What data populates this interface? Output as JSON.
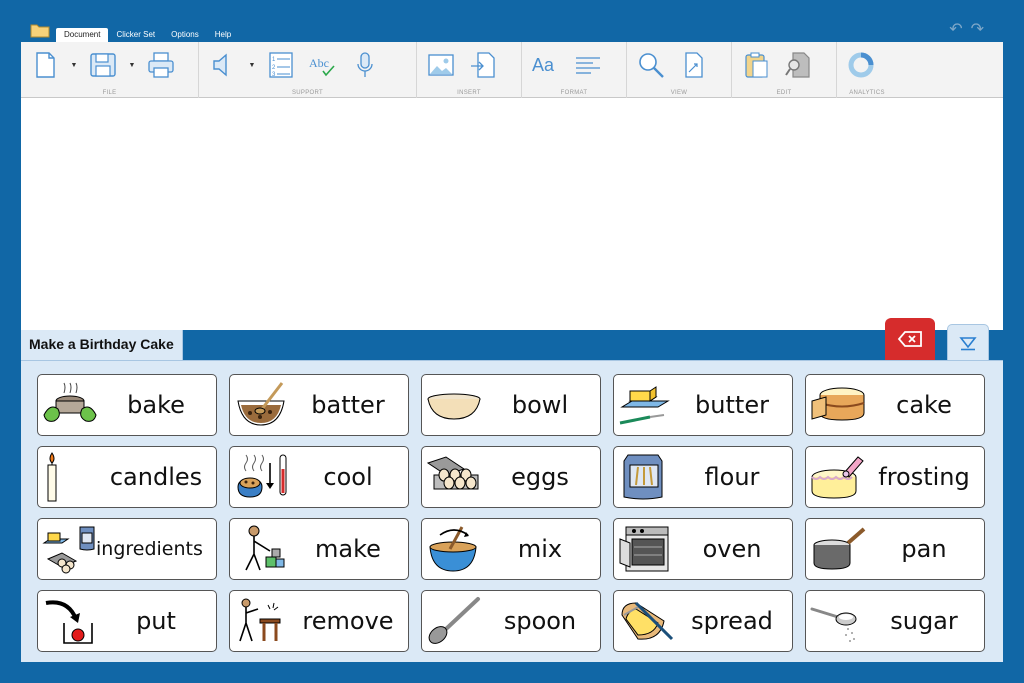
{
  "menu": {
    "tabs": [
      "Document",
      "Clicker Set",
      "Options",
      "Help"
    ],
    "active": 0
  },
  "ribbon": {
    "groups": [
      "FILE",
      "SUPPORT",
      "INSERT",
      "FORMAT",
      "VIEW",
      "EDIT",
      "ANALYTICS"
    ],
    "format_font_label": "Aa",
    "spell_label": "Abc"
  },
  "set": {
    "title": "Make a Birthday Cake"
  },
  "cells": [
    {
      "word": "bake",
      "icon": "bake-icon"
    },
    {
      "word": "batter",
      "icon": "batter-icon"
    },
    {
      "word": "bowl",
      "icon": "bowl-icon"
    },
    {
      "word": "butter",
      "icon": "butter-icon"
    },
    {
      "word": "cake",
      "icon": "cake-icon"
    },
    {
      "word": "candles",
      "icon": "candles-icon"
    },
    {
      "word": "cool",
      "icon": "cool-icon"
    },
    {
      "word": "eggs",
      "icon": "eggs-icon"
    },
    {
      "word": "flour",
      "icon": "flour-icon"
    },
    {
      "word": "frosting",
      "icon": "frosting-icon"
    },
    {
      "word": "ingredients",
      "icon": "ingredients-icon"
    },
    {
      "word": "make",
      "icon": "make-icon"
    },
    {
      "word": "mix",
      "icon": "mix-icon"
    },
    {
      "word": "oven",
      "icon": "oven-icon"
    },
    {
      "word": "pan",
      "icon": "pan-icon"
    },
    {
      "word": "put",
      "icon": "put-icon"
    },
    {
      "word": "remove",
      "icon": "remove-icon"
    },
    {
      "word": "spoon",
      "icon": "spoon-icon"
    },
    {
      "word": "spread",
      "icon": "spread-icon"
    },
    {
      "word": "sugar",
      "icon": "sugar-icon"
    }
  ],
  "colors": {
    "frame": "#1167a6",
    "grid_bg": "#dbe9f6",
    "delete": "#d62c2c"
  }
}
